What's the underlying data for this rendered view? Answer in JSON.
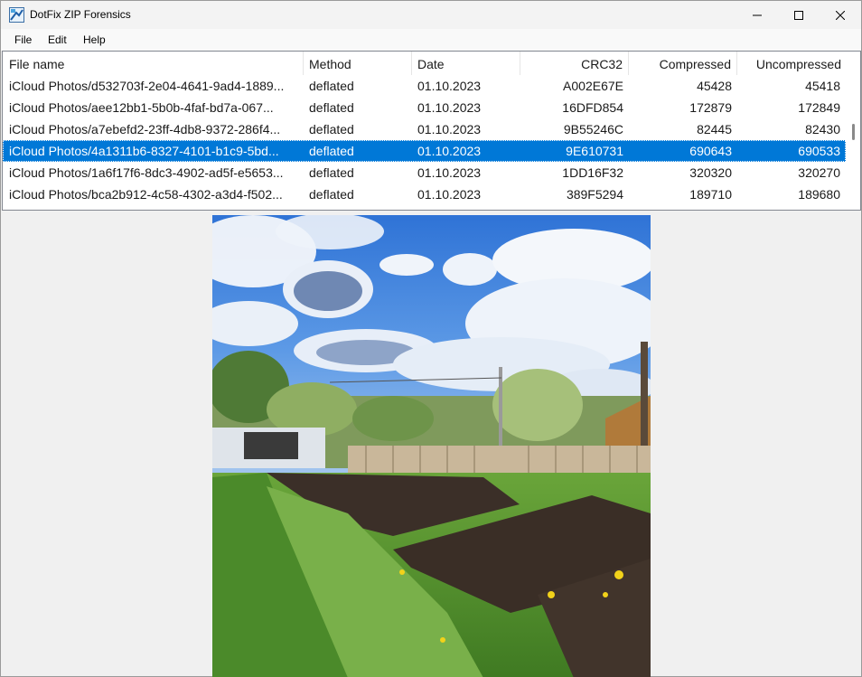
{
  "window": {
    "title": "DotFix ZIP Forensics"
  },
  "menu": [
    "File",
    "Edit",
    "Help"
  ],
  "columns": [
    "File name",
    "Method",
    "Date",
    "CRC32",
    "Compressed",
    "Uncompressed"
  ],
  "rows": [
    {
      "name": "iCloud Photos/d532703f-2e04-4641-9ad4-1889...",
      "method": "deflated",
      "date": "01.10.2023",
      "crc": "A002E67E",
      "compressed": "45428",
      "uncompressed": "45418"
    },
    {
      "name": "iCloud Photos/aee12bb1-5b0b-4faf-bd7a-067...",
      "method": "deflated",
      "date": "01.10.2023",
      "crc": "16DFD854",
      "compressed": "172879",
      "uncompressed": "172849"
    },
    {
      "name": "iCloud Photos/a7ebefd2-23ff-4db8-9372-286f4...",
      "method": "deflated",
      "date": "01.10.2023",
      "crc": "9B55246C",
      "compressed": "82445",
      "uncompressed": "82430"
    },
    {
      "name": "iCloud Photos/4a1311b6-8327-4101-b1c9-5bd...",
      "method": "deflated",
      "date": "01.10.2023",
      "crc": "9E610731",
      "compressed": "690643",
      "uncompressed": "690533",
      "selected": true
    },
    {
      "name": "iCloud Photos/1a6f17f6-8dc3-4902-ad5f-e5653...",
      "method": "deflated",
      "date": "01.10.2023",
      "crc": "1DD16F32",
      "compressed": "320320",
      "uncompressed": "320270"
    },
    {
      "name": "iCloud Photos/bca2b912-4c58-4302-a3d4-f502...",
      "method": "deflated",
      "date": "01.10.2023",
      "crc": "389F5294",
      "compressed": "189710",
      "uncompressed": "189680"
    }
  ],
  "icons": {
    "app": "app-icon",
    "minimize": "minimize-icon",
    "maximize": "maximize-icon",
    "close": "close-icon"
  },
  "colors": {
    "selection": "#0078d7"
  }
}
